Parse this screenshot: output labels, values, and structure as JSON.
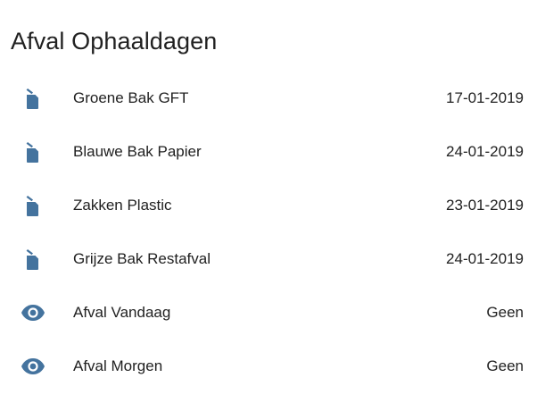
{
  "card": {
    "title": "Afval Ophaaldagen"
  },
  "colors": {
    "icon": "#44739e",
    "text": "#212121",
    "background": "#ffffff"
  },
  "entities": [
    {
      "icon": "trash-can-icon",
      "name": "Groene Bak GFT",
      "state": "17-01-2019"
    },
    {
      "icon": "trash-can-icon",
      "name": "Blauwe Bak Papier",
      "state": "24-01-2019"
    },
    {
      "icon": "trash-can-icon",
      "name": "Zakken Plastic",
      "state": "23-01-2019"
    },
    {
      "icon": "trash-can-icon",
      "name": "Grijze Bak Restafval",
      "state": "24-01-2019"
    },
    {
      "icon": "eye-icon",
      "name": "Afval Vandaag",
      "state": "Geen"
    },
    {
      "icon": "eye-icon",
      "name": "Afval Morgen",
      "state": "Geen"
    }
  ]
}
